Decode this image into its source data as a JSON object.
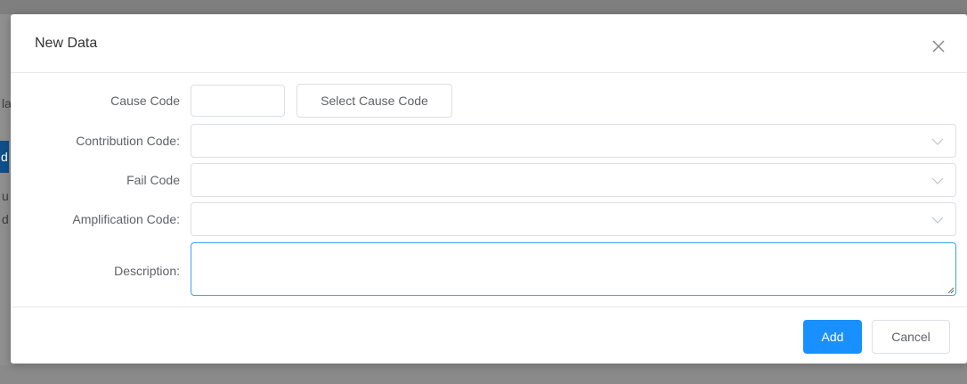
{
  "dialog": {
    "title": "New Data",
    "close_icon": "close-icon"
  },
  "form": {
    "cause_code": {
      "label": "Cause Code",
      "value": "",
      "placeholder": "",
      "select_button_label": "Select Cause Code"
    },
    "contribution_code": {
      "label": "Contribution Code:",
      "value": ""
    },
    "fail_code": {
      "label": "Fail Code",
      "value": ""
    },
    "amplification_code": {
      "label": "Amplification Code:",
      "value": ""
    },
    "description": {
      "label": "Description:",
      "value": ""
    }
  },
  "footer": {
    "add_label": "Add",
    "cancel_label": "Cancel"
  },
  "background": {
    "fragments": [
      "la",
      "d",
      "u",
      "d"
    ]
  },
  "colors": {
    "primary": "#1890ff",
    "focus_border": "#409eff",
    "border": "#dcdfe6",
    "label_text": "#606266",
    "overlay": "#8e8e8e"
  }
}
